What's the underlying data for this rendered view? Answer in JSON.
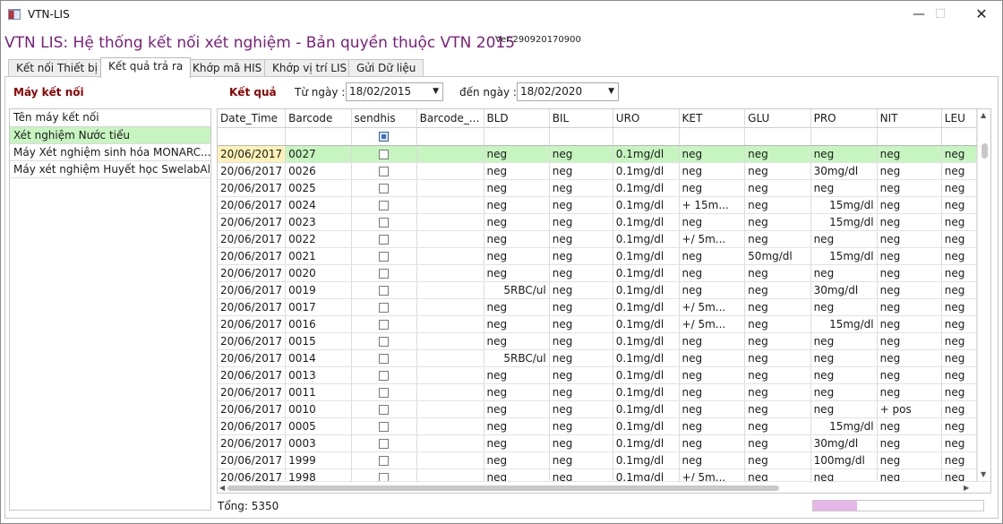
{
  "window": {
    "title": "VTN-LIS",
    "minimize": "—",
    "maximize": "☐",
    "close": "✕"
  },
  "header": {
    "title": "VTN LIS: Hệ thống kết nối xét nghiệm - Bản quyền thuộc VTN 2015",
    "version": "Ver:290920170900"
  },
  "tabs": [
    "Kết nối Thiết bị",
    "Kết quả trả ra",
    "Khớp mã HIS",
    "Khớp vị trí LIS",
    "Gửi Dữ liệu"
  ],
  "active_tab": 1,
  "left": {
    "header": "Máy kết nối",
    "column": "Tên máy kết nối",
    "devices": [
      "Xét nghiệm Nước tiểu",
      "Máy Xét nghiệm sinh hóa MONARC...",
      "Máy xét nghiệm Huyết học SwelabAlfa"
    ]
  },
  "filters": {
    "result_label": "Kết quả",
    "from_label": "Từ ngày :",
    "from_value": "18/02/2015",
    "to_label": "đến ngày :",
    "to_value": "18/02/2020"
  },
  "grid": {
    "columns": [
      "Date_Time",
      "Barcode",
      "sendhis",
      "Barcode_...",
      "BLD",
      "BIL",
      "URO",
      "KET",
      "GLU",
      "PRO",
      "NIT",
      "LEU"
    ],
    "rows": [
      [
        "20/06/2017",
        "0027",
        "",
        "",
        "neg",
        "neg",
        "0.1mg/dl",
        "neg",
        "neg",
        "neg",
        "neg",
        "neg"
      ],
      [
        "20/06/2017",
        "0026",
        "",
        "",
        "neg",
        "neg",
        "0.1mg/dl",
        "neg",
        "neg",
        "30mg/dl",
        "neg",
        "neg"
      ],
      [
        "20/06/2017",
        "0025",
        "",
        "",
        "neg",
        "neg",
        "0.1mg/dl",
        "neg",
        "neg",
        "neg",
        "neg",
        "neg"
      ],
      [
        "20/06/2017",
        "0024",
        "",
        "",
        "neg",
        "neg",
        "0.1mg/dl",
        "+     15m...",
        "neg",
        "15mg/dl",
        "neg",
        "neg"
      ],
      [
        "20/06/2017",
        "0023",
        "",
        "",
        "neg",
        "neg",
        "0.1mg/dl",
        "neg",
        "neg",
        "15mg/dl",
        "neg",
        "neg"
      ],
      [
        "20/06/2017",
        "0022",
        "",
        "",
        "neg",
        "neg",
        "0.1mg/dl",
        "+/      5m...",
        "neg",
        "neg",
        "neg",
        "neg"
      ],
      [
        "20/06/2017",
        "0021",
        "",
        "",
        "neg",
        "neg",
        "0.1mg/dl",
        "neg",
        "50mg/dl",
        "15mg/dl",
        "neg",
        "neg"
      ],
      [
        "20/06/2017",
        "0020",
        "",
        "",
        "neg",
        "neg",
        "0.1mg/dl",
        "neg",
        "neg",
        "neg",
        "neg",
        "neg"
      ],
      [
        "20/06/2017",
        "0019",
        "",
        "",
        "5RBC/ul",
        "neg",
        "0.1mg/dl",
        "neg",
        "neg",
        "30mg/dl",
        "neg",
        "neg"
      ],
      [
        "20/06/2017",
        "0017",
        "",
        "",
        "neg",
        "neg",
        "0.1mg/dl",
        "+/      5m...",
        "neg",
        "neg",
        "neg",
        "neg"
      ],
      [
        "20/06/2017",
        "0016",
        "",
        "",
        "neg",
        "neg",
        "0.1mg/dl",
        "+/      5m...",
        "neg",
        "15mg/dl",
        "neg",
        "neg"
      ],
      [
        "20/06/2017",
        "0015",
        "",
        "",
        "neg",
        "neg",
        "0.1mg/dl",
        "neg",
        "neg",
        "neg",
        "neg",
        "neg"
      ],
      [
        "20/06/2017",
        "0014",
        "",
        "",
        "5RBC/ul",
        "neg",
        "0.1mg/dl",
        "neg",
        "neg",
        "neg",
        "neg",
        "neg"
      ],
      [
        "20/06/2017",
        "0013",
        "",
        "",
        "neg",
        "neg",
        "0.1mg/dl",
        "neg",
        "neg",
        "neg",
        "neg",
        "neg"
      ],
      [
        "20/06/2017",
        "0011",
        "",
        "",
        "neg",
        "neg",
        "0.1mg/dl",
        "neg",
        "neg",
        "neg",
        "neg",
        "neg"
      ],
      [
        "20/06/2017",
        "0010",
        "",
        "",
        "neg",
        "neg",
        "0.1mg/dl",
        "neg",
        "neg",
        "neg",
        "+          pos",
        "neg"
      ],
      [
        "20/06/2017",
        "0005",
        "",
        "",
        "neg",
        "neg",
        "0.1mg/dl",
        "neg",
        "neg",
        "15mg/dl",
        "neg",
        "neg"
      ],
      [
        "20/06/2017",
        "0003",
        "",
        "",
        "neg",
        "neg",
        "0.1mg/dl",
        "neg",
        "neg",
        "30mg/dl",
        "neg",
        "neg"
      ],
      [
        "20/06/2017",
        "1999",
        "",
        "",
        "neg",
        "neg",
        "0.1mg/dl",
        "neg",
        "neg",
        "100mg/dl",
        "neg",
        "neg"
      ],
      [
        "20/06/2017",
        "1998",
        "",
        "",
        "neg",
        "neg",
        "0.1mg/dl",
        "+/      5m...",
        "neg",
        "neg",
        "neg",
        "neg"
      ]
    ],
    "right_aligned": [
      "5RBC/ul",
      "15mg/dl"
    ]
  },
  "footer": {
    "total": "Tổng: 5350",
    "progress_fraction": 0.26
  },
  "colors": {
    "title": "#7a1e7a",
    "section_header": "#8b0000",
    "selected_row": "#c6f5c0",
    "selected_cell": "#fff2b8",
    "progress": "#e7b6e8"
  }
}
